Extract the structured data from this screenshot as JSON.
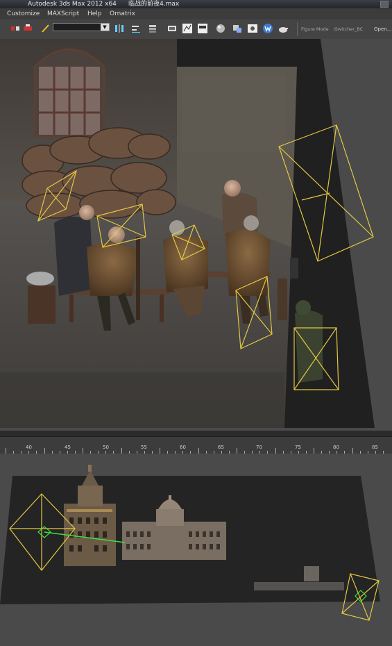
{
  "window": {
    "app_title": "Autodesk 3ds Max  2012 x64",
    "file_title": "临战的前夜4.max"
  },
  "menu": [
    "Customize",
    "MAXScript",
    "Help",
    "Ornatrix"
  ],
  "toolbar": {
    "mode_left": "Figure Mode",
    "mode_right": "iSwitcher_BC",
    "open_label": "Open..."
  },
  "timeline": {
    "ticks": [
      "40",
      "45",
      "50",
      "55",
      "60",
      "65",
      "70",
      "75",
      "80",
      "85"
    ]
  },
  "colors": {
    "ui_dark": "#2b2b2b",
    "viewport_bg": "#4a4a4a",
    "helper_wire": "#e3c842",
    "link_line": "#40e040"
  },
  "icons": [
    "3dsmax-logo-icon",
    "link-icon",
    "unlink-icon",
    "select-filter-icon",
    "mirror-icon",
    "align-icon",
    "layer-icon",
    "ribbon-icon",
    "curve-editor-icon",
    "schematic-icon",
    "material-editor-icon",
    "render-setup-icon",
    "render-frame-icon",
    "render-icon",
    "teapot-icon"
  ]
}
